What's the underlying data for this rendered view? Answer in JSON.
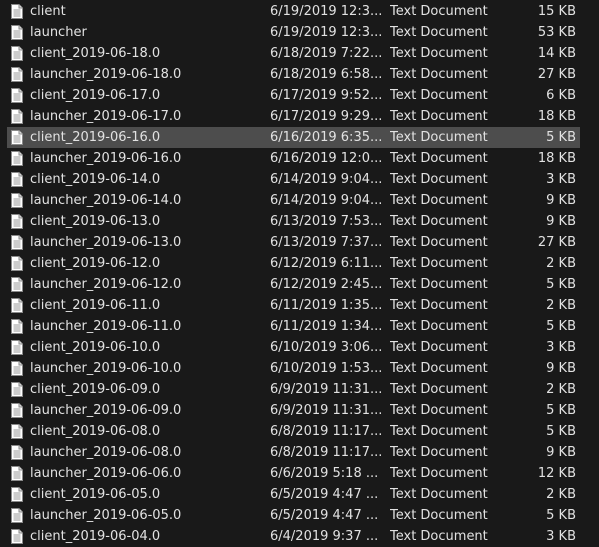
{
  "files": [
    {
      "name": "client",
      "date": "6/19/2019 12:3...",
      "type": "Text Document",
      "size": "15 KB",
      "icon": "text-document-icon"
    },
    {
      "name": "launcher",
      "date": "6/19/2019 12:3...",
      "type": "Text Document",
      "size": "53 KB",
      "icon": "text-document-icon"
    },
    {
      "name": "client_2019-06-18.0",
      "date": "6/18/2019 7:22...",
      "type": "Text Document",
      "size": "14 KB",
      "icon": "text-document-icon"
    },
    {
      "name": "launcher_2019-06-18.0",
      "date": "6/18/2019 6:58...",
      "type": "Text Document",
      "size": "27 KB",
      "icon": "text-document-icon"
    },
    {
      "name": "client_2019-06-17.0",
      "date": "6/17/2019 9:52...",
      "type": "Text Document",
      "size": "6 KB",
      "icon": "text-document-icon"
    },
    {
      "name": "launcher_2019-06-17.0",
      "date": "6/17/2019 9:29...",
      "type": "Text Document",
      "size": "18 KB",
      "icon": "text-document-icon"
    },
    {
      "name": "client_2019-06-16.0",
      "date": "6/16/2019 6:35...",
      "type": "Text Document",
      "size": "5 KB",
      "icon": "text-document-icon",
      "selected": true
    },
    {
      "name": "launcher_2019-06-16.0",
      "date": "6/16/2019 12:0...",
      "type": "Text Document",
      "size": "18 KB",
      "icon": "text-document-icon"
    },
    {
      "name": "client_2019-06-14.0",
      "date": "6/14/2019 9:04...",
      "type": "Text Document",
      "size": "3 KB",
      "icon": "text-document-icon"
    },
    {
      "name": "launcher_2019-06-14.0",
      "date": "6/14/2019 9:04...",
      "type": "Text Document",
      "size": "9 KB",
      "icon": "text-document-icon"
    },
    {
      "name": "client_2019-06-13.0",
      "date": "6/13/2019 7:53...",
      "type": "Text Document",
      "size": "9 KB",
      "icon": "text-document-icon"
    },
    {
      "name": "launcher_2019-06-13.0",
      "date": "6/13/2019 7:37...",
      "type": "Text Document",
      "size": "27 KB",
      "icon": "text-document-icon"
    },
    {
      "name": "client_2019-06-12.0",
      "date": "6/12/2019 6:11...",
      "type": "Text Document",
      "size": "2 KB",
      "icon": "text-document-icon"
    },
    {
      "name": "launcher_2019-06-12.0",
      "date": "6/12/2019 2:45...",
      "type": "Text Document",
      "size": "5 KB",
      "icon": "text-document-icon"
    },
    {
      "name": "client_2019-06-11.0",
      "date": "6/11/2019 1:35...",
      "type": "Text Document",
      "size": "2 KB",
      "icon": "text-document-icon"
    },
    {
      "name": "launcher_2019-06-11.0",
      "date": "6/11/2019 1:34...",
      "type": "Text Document",
      "size": "5 KB",
      "icon": "text-document-icon"
    },
    {
      "name": "client_2019-06-10.0",
      "date": "6/10/2019 3:06...",
      "type": "Text Document",
      "size": "3 KB",
      "icon": "text-document-icon"
    },
    {
      "name": "launcher_2019-06-10.0",
      "date": "6/10/2019 1:53...",
      "type": "Text Document",
      "size": "9 KB",
      "icon": "text-document-icon"
    },
    {
      "name": "client_2019-06-09.0",
      "date": "6/9/2019 11:31...",
      "type": "Text Document",
      "size": "2 KB",
      "icon": "text-document-icon"
    },
    {
      "name": "launcher_2019-06-09.0",
      "date": "6/9/2019 11:31...",
      "type": "Text Document",
      "size": "5 KB",
      "icon": "text-document-icon"
    },
    {
      "name": "client_2019-06-08.0",
      "date": "6/8/2019 11:17...",
      "type": "Text Document",
      "size": "5 KB",
      "icon": "text-document-icon"
    },
    {
      "name": "launcher_2019-06-08.0",
      "date": "6/8/2019 11:17...",
      "type": "Text Document",
      "size": "9 KB",
      "icon": "text-document-icon"
    },
    {
      "name": "launcher_2019-06-06.0",
      "date": "6/6/2019 5:18 ...",
      "type": "Text Document",
      "size": "12 KB",
      "icon": "text-document-icon"
    },
    {
      "name": "client_2019-06-05.0",
      "date": "6/5/2019 4:47 ...",
      "type": "Text Document",
      "size": "2 KB",
      "icon": "text-document-icon"
    },
    {
      "name": "launcher_2019-06-05.0",
      "date": "6/5/2019 4:47 ...",
      "type": "Text Document",
      "size": "5 KB",
      "icon": "text-document-icon"
    },
    {
      "name": "client_2019-06-04.0",
      "date": "6/4/2019 9:37 ...",
      "type": "Text Document",
      "size": "3 KB",
      "icon": "text-document-icon"
    }
  ],
  "colors": {
    "background": "#191919",
    "selection": "#4d4d4d",
    "text": "#e2e2e2"
  }
}
